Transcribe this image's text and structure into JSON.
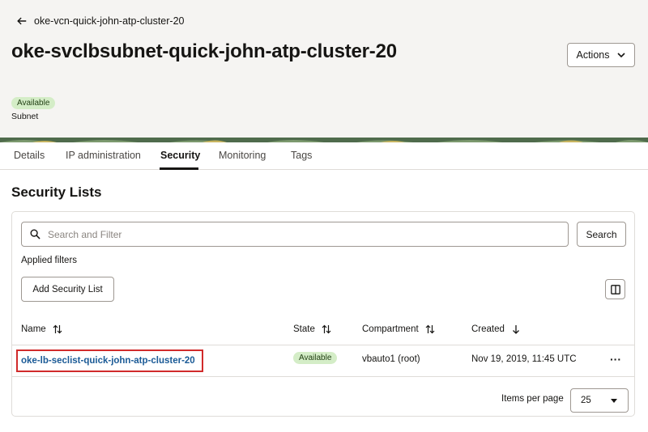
{
  "header": {
    "back_link": "oke-vcn-quick-john-atp-cluster-20",
    "title": "oke-svclbsubnet-quick-john-atp-cluster-20",
    "actions_label": "Actions",
    "status": "Available",
    "resource_type": "Subnet"
  },
  "tabs": [
    {
      "label": "Details"
    },
    {
      "label": "IP administration"
    },
    {
      "label": "Security",
      "active": true
    },
    {
      "label": "Monitoring"
    },
    {
      "label": "Tags"
    }
  ],
  "section": {
    "title": "Security Lists",
    "search_placeholder": "Search and Filter",
    "search_button": "Search",
    "applied_filters": "Applied filters",
    "add_button": "Add Security List"
  },
  "table": {
    "columns": [
      {
        "label": "Name",
        "sort": "both"
      },
      {
        "label": "State",
        "sort": "both"
      },
      {
        "label": "Compartment",
        "sort": "both"
      },
      {
        "label": "Created",
        "sort": "desc"
      }
    ],
    "rows": [
      {
        "name": "oke-lb-seclist-quick-john-atp-cluster-20",
        "state": "Available",
        "compartment": "vbauto1 (root)",
        "created": "Nov 19, 2019, 11:45 UTC",
        "actions": "···"
      }
    ]
  },
  "pagination": {
    "label": "Items per page",
    "value": "25"
  },
  "colors": {
    "link": "#1a5a96",
    "badge_bg": "#d4edc7",
    "highlight": "#d12b2b"
  }
}
